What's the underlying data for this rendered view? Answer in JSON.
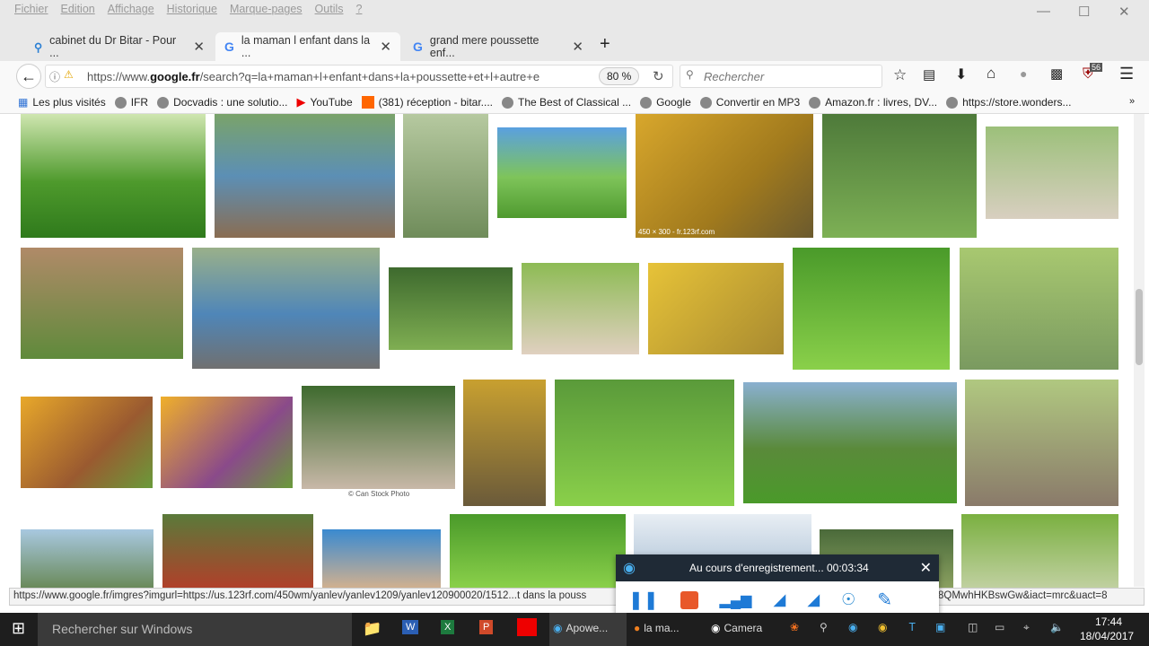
{
  "menu": [
    "Fichier",
    "Edition",
    "Affichage",
    "Historique",
    "Marque-pages",
    "Outils",
    "?"
  ],
  "tabs": [
    {
      "label": "cabinet du Dr Bitar - Pour ..."
    },
    {
      "label": "la maman l enfant dans la ..."
    },
    {
      "label": "grand mere poussette enf..."
    }
  ],
  "new_tab": "+",
  "url_prefix": "https://www.",
  "url_domain": "google.fr",
  "url_rest": "/search?q=la+maman+l+enfant+dans+la+poussette+et+l+autre+e",
  "zoom": "80 %",
  "search_placeholder": "Rechercher",
  "badge_count": "56",
  "bookmarks": [
    "Les plus visités",
    "IFR",
    "Docvadis : une solutio...",
    "YouTube",
    "(381) réception - bitar....",
    "The Best of Classical ...",
    "Google",
    "Convertir en MP3",
    "Amazon.fr : livres, DV...",
    "https://store.wonders..."
  ],
  "captions": {
    "img_size": "450 × 300 - fr.123rf.com",
    "canstock": "© Can Stock Photo"
  },
  "status_url": "https://www.google.fr/imgres?imgurl=https://us.123rf.com/450wm/yanlev/yanlev1209/yanlev120900020/1512...t dans la pouss",
  "status_url_end": "8QMwhHKBswGw&iact=mrc&uact=8",
  "recorder": {
    "title": "Au cours d'enregistrement... 00:03:34"
  },
  "taskbar": {
    "search": "Rechercher sur Windows",
    "apowersoft": "Apowe...",
    "firefox": "la ma...",
    "camera": "Camera",
    "time": "17:44",
    "date": "18/04/2017"
  }
}
